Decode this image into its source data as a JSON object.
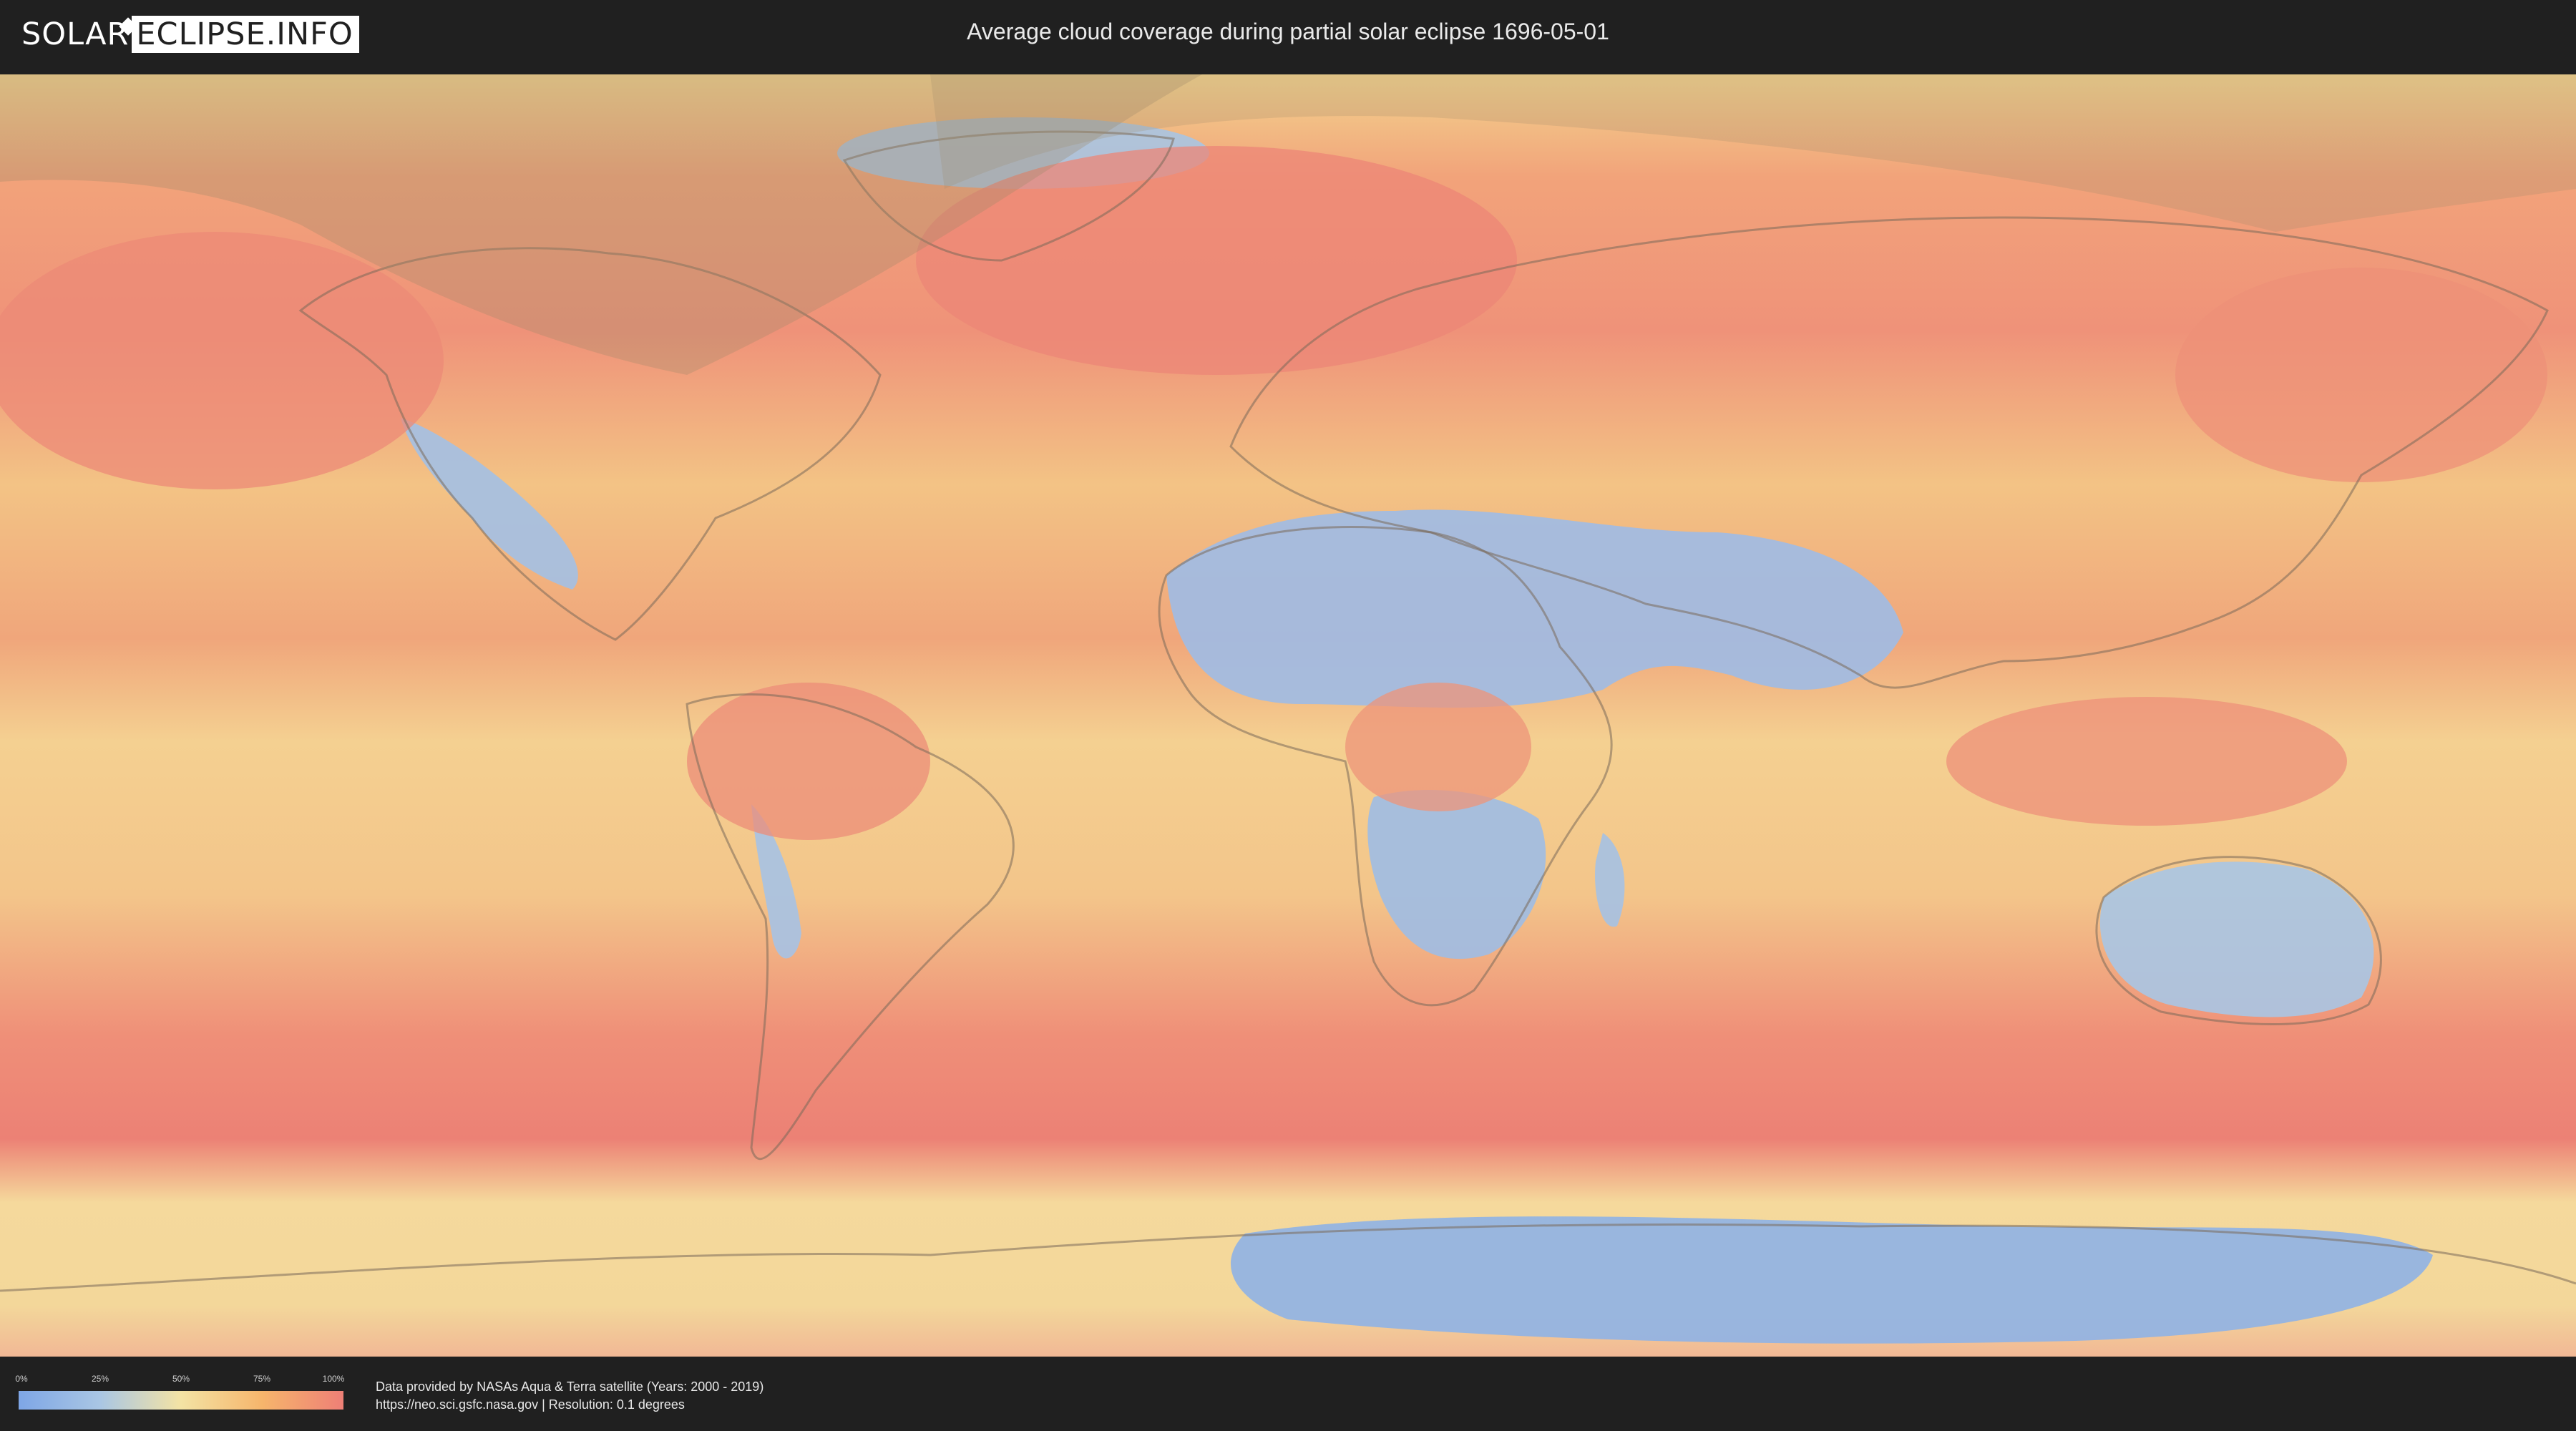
{
  "header": {
    "logo_part1": "SOLAR",
    "logo_part2": "ECLIPSE.INFO",
    "title": "Average cloud coverage during partial solar eclipse 1696-05-01"
  },
  "map": {
    "legend": {
      "ticks": [
        "0%",
        "25%",
        "50%",
        "75%",
        "100%"
      ],
      "colors": [
        "#7ea6e6",
        "#a9c6e4",
        "#f4e3a4",
        "#f6b56c",
        "#ee7f76"
      ]
    }
  },
  "footer": {
    "source_line1": "Data provided by NASAs Aqua & Terra satellite (Years: 2000 - 2019)",
    "source_line2": "https://neo.sci.gsfc.nasa.gov | Resolution: 0.1 degrees"
  }
}
